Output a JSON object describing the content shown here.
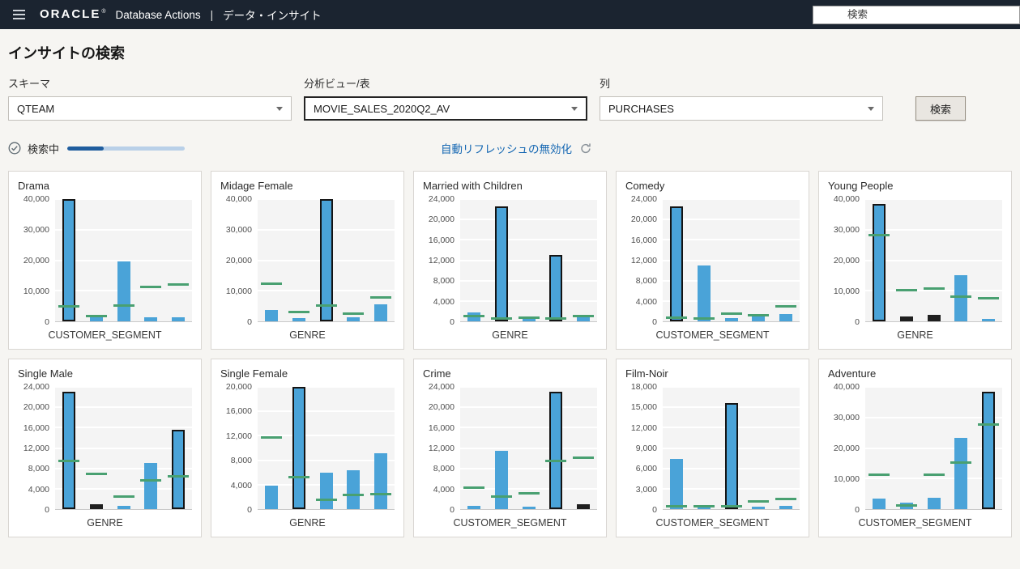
{
  "header": {
    "brand": "ORACLE",
    "brand_mark": "®",
    "app_name": "Database Actions",
    "separator": "|",
    "page_name": "データ・インサイト",
    "search_placeholder": "検索"
  },
  "page": {
    "title": "インサイトの検索"
  },
  "filters": {
    "schema": {
      "label": "スキーマ",
      "value": "QTEAM"
    },
    "analytic_view": {
      "label": "分析ビュー/表",
      "value": "MOVIE_SALES_2020Q2_AV"
    },
    "column": {
      "label": "列",
      "value": "PURCHASES"
    },
    "search_button": "検索"
  },
  "status": {
    "text": "検索中",
    "progress_percent": 31,
    "refresh_link": "自動リフレッシュの無効化"
  },
  "colors": {
    "header_bg": "#1b2430",
    "bar": "#4aa3d8",
    "bar_dark": "#1f1f1f",
    "bar_outline": "#141414",
    "expected_marker": "#49a071",
    "link": "#1366b2",
    "progress_fill": "#1f5d9e",
    "progress_track": "#b9d0e8"
  },
  "chart_data": [
    {
      "type": "bar",
      "title": "Drama",
      "xlabel": "CUSTOMER_SEGMENT",
      "ymax": 40000,
      "ytick_step": 10000,
      "values": [
        40000,
        1200,
        19500,
        1300,
        1300
      ],
      "styles": [
        "highlight",
        "normal",
        "normal",
        "normal",
        "normal"
      ],
      "expected": [
        4700,
        1500,
        5000,
        11000,
        12000
      ]
    },
    {
      "type": "bar",
      "title": "Midage Female",
      "xlabel": "GENRE",
      "ymax": 40000,
      "ytick_step": 10000,
      "values": [
        3800,
        1000,
        40000,
        1200,
        5600
      ],
      "styles": [
        "normal",
        "normal",
        "highlight",
        "normal",
        "normal"
      ],
      "expected": [
        12200,
        2800,
        5000,
        2500,
        7800
      ]
    },
    {
      "type": "bar",
      "title": "Married with Children",
      "xlabel": "GENRE",
      "ymax": 24000,
      "ytick_step": 4000,
      "values": [
        1800,
        22500,
        800,
        13000,
        1000
      ],
      "styles": [
        "normal",
        "highlight",
        "normal",
        "highlight",
        "normal"
      ],
      "expected": [
        1000,
        400,
        700,
        500,
        900
      ]
    },
    {
      "type": "bar",
      "title": "Comedy",
      "xlabel": "CUSTOMER_SEGMENT",
      "ymax": 24000,
      "ytick_step": 4000,
      "values": [
        22500,
        11000,
        700,
        1000,
        1500
      ],
      "styles": [
        "highlight",
        "normal",
        "normal",
        "normal",
        "normal"
      ],
      "expected": [
        600,
        400,
        1400,
        1100,
        2800
      ]
    },
    {
      "type": "bar",
      "title": "Young People",
      "xlabel": "GENRE",
      "ymax": 40000,
      "ytick_step": 10000,
      "values": [
        38400,
        1500,
        2000,
        15000,
        900
      ],
      "styles": [
        "highlight",
        "dark",
        "dark",
        "normal",
        "normal"
      ],
      "expected": [
        28000,
        10000,
        10500,
        8000,
        7500
      ]
    },
    {
      "type": "bar",
      "title": "Single Male",
      "xlabel": "GENRE",
      "ymax": 24000,
      "ytick_step": 4000,
      "values": [
        23100,
        900,
        600,
        9000,
        15600
      ],
      "styles": [
        "highlight",
        "dark",
        "normal",
        "normal",
        "highlight"
      ],
      "expected": [
        9400,
        6800,
        2400,
        5500,
        6400
      ]
    },
    {
      "type": "bar",
      "title": "Single Female",
      "xlabel": "GENRE",
      "ymax": 20000,
      "ytick_step": 4000,
      "values": [
        3800,
        20000,
        5900,
        6300,
        9200
      ],
      "styles": [
        "normal",
        "highlight",
        "normal",
        "normal",
        "normal"
      ],
      "expected": [
        11600,
        5200,
        1500,
        2200,
        2400
      ]
    },
    {
      "type": "bar",
      "title": "Crime",
      "xlabel": "CUSTOMER_SEGMENT",
      "ymax": 24000,
      "ytick_step": 4000,
      "values": [
        600,
        11400,
        500,
        23000,
        1000
      ],
      "styles": [
        "normal",
        "normal",
        "normal",
        "highlight",
        "dark"
      ],
      "expected": [
        4100,
        2400,
        3000,
        9400,
        10000
      ]
    },
    {
      "type": "bar",
      "title": "Film-Noir",
      "xlabel": "CUSTOMER_SEGMENT",
      "ymax": 18000,
      "ytick_step": 3000,
      "values": [
        7400,
        300,
        15600,
        400,
        500
      ],
      "styles": [
        "normal",
        "normal",
        "highlight",
        "normal",
        "normal"
      ],
      "expected": [
        300,
        300,
        400,
        1100,
        1400
      ]
    },
    {
      "type": "bar",
      "title": "Adventure",
      "xlabel": "CUSTOMER_SEGMENT",
      "ymax": 40000,
      "ytick_step": 10000,
      "values": [
        3400,
        2000,
        3700,
        23400,
        38400
      ],
      "styles": [
        "normal",
        "normal",
        "normal",
        "normal",
        "highlight"
      ],
      "expected": [
        11000,
        1000,
        11200,
        15000,
        27500
      ]
    }
  ]
}
